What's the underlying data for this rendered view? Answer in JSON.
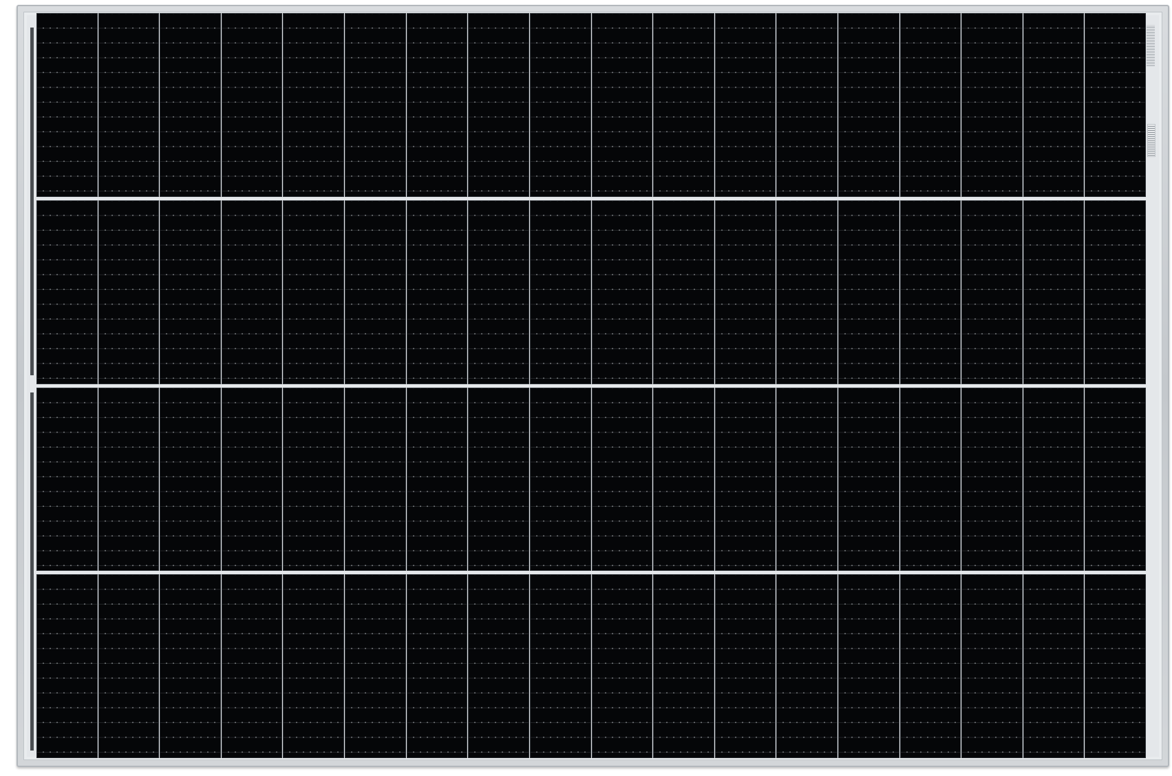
{
  "image": {
    "subject": "solar-panel",
    "cell_grid": {
      "columns": 18,
      "rows": 4
    },
    "colors": {
      "cell": "#050608",
      "frame": "#c4c8cc",
      "busbar_gap": "#e4e7ea",
      "background": "#ffffff"
    }
  }
}
